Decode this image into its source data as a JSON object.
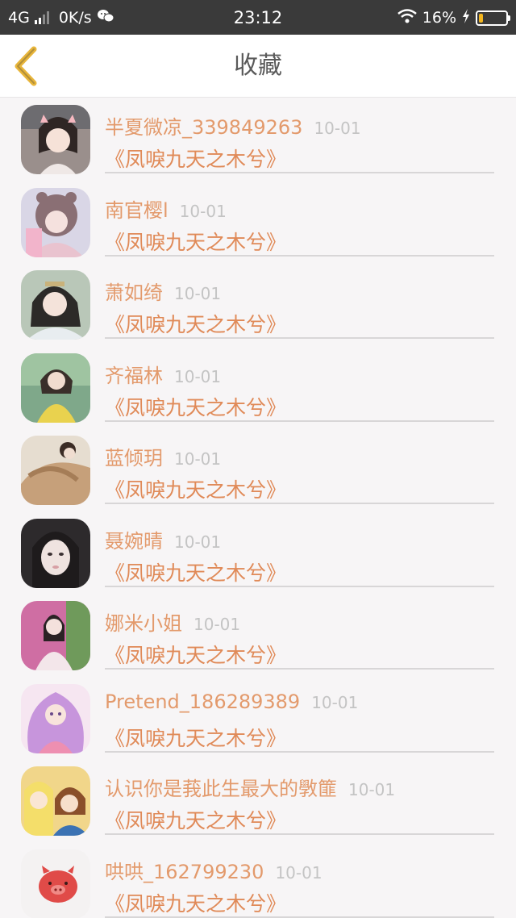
{
  "status_bar": {
    "network": "4G",
    "speed": "0K/s",
    "time": "23:12",
    "battery": "16%",
    "battery_level": 0.16,
    "icons": [
      "signal-icon",
      "wechat-icon",
      "wifi-icon",
      "charging-icon",
      "battery-icon"
    ]
  },
  "nav": {
    "title": "收藏",
    "back_icon": "chevron-left-icon",
    "accent": "#e8b53a"
  },
  "colors": {
    "name": "#e39a6c",
    "book": "#e08a58",
    "date": "#c4c4c4"
  },
  "items": [
    {
      "name": "半夏微凉_339849263",
      "date": "10-01",
      "book": "《凤唳九天之木兮》"
    },
    {
      "name": "南官樱l",
      "date": "10-01",
      "book": "《凤唳九天之木兮》"
    },
    {
      "name": "萧如绮",
      "date": "10-01",
      "book": "《凤唳九天之木兮》"
    },
    {
      "name": "齐福林",
      "date": "10-01",
      "book": "《凤唳九天之木兮》"
    },
    {
      "name": "蓝倾玥",
      "date": "10-01",
      "book": "《凤唳九天之木兮》"
    },
    {
      "name": "聂婉晴",
      "date": "10-01",
      "book": "《凤唳九天之木兮》"
    },
    {
      "name": "娜米小姐",
      "date": "10-01",
      "book": "《凤唳九天之木兮》"
    },
    {
      "name": "Pretend_186289389",
      "date": "10-01",
      "book": "《凤唳九天之木兮》"
    },
    {
      "name": "认识你是莪此生最大的斆篚",
      "date": "10-01",
      "book": "《凤唳九天之木兮》"
    },
    {
      "name": "哄哄_162799230",
      "date": "10-01",
      "book": "《凤唳九天之木兮》"
    }
  ]
}
